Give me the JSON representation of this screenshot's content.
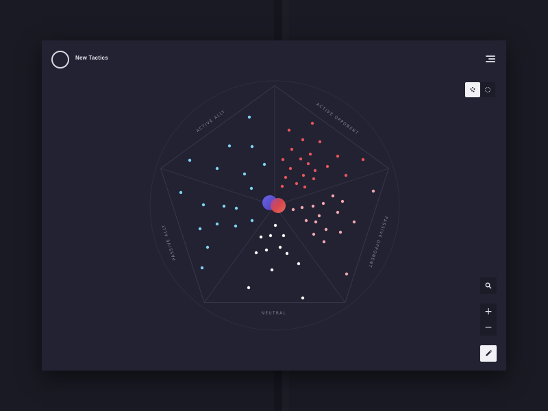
{
  "app": {
    "title": "New Tactics"
  },
  "colors": {
    "background": "#1a1a24",
    "card": "#222232",
    "ally": "#7fd3f2",
    "opponent": "#e8545a",
    "passive_opponent": "#f2a7b0",
    "neutral": "#ffffff",
    "grid": "#3a3a4c"
  },
  "icons": {
    "logo": "ring-logo-icon",
    "menu": "hamburger-menu-icon",
    "view_dots": "dots-cluster-icon",
    "view_circle": "circle-dots-icon",
    "search": "search-icon",
    "zoom_in": "plus-icon",
    "zoom_out": "minus-icon",
    "edit": "pencil-icon"
  },
  "controls": {
    "zoom_in_label": "+",
    "zoom_out_label": "−",
    "active_view": "dots"
  },
  "chart_data": {
    "type": "scatter",
    "categories": [
      "ACTIVE ALLY",
      "ACTIVE OPPONENT",
      "PASSIVE OPPONENT",
      "NEUTRAL",
      "PASSIVE ALLY"
    ],
    "series": [
      {
        "name": "ACTIVE ALLY",
        "color": "#7fd3f2",
        "points": [
          [
            364,
            171
          ],
          [
            335,
            213
          ],
          [
            368,
            214
          ],
          [
            277,
            234
          ],
          [
            386,
            240
          ],
          [
            317,
            246
          ],
          [
            357,
            254
          ],
          [
            367,
            275
          ]
        ]
      },
      {
        "name": "ACTIVE OPPONENT",
        "color": "#e8545a",
        "points": [
          [
            456,
            180
          ],
          [
            422,
            190
          ],
          [
            442,
            204
          ],
          [
            467,
            207
          ],
          [
            426,
            218
          ],
          [
            453,
            225
          ],
          [
            413,
            233
          ],
          [
            439,
            232
          ],
          [
            493,
            228
          ],
          [
            450,
            239
          ],
          [
            478,
            243
          ],
          [
            530,
            233
          ],
          [
            424,
            246
          ],
          [
            460,
            249
          ],
          [
            443,
            256
          ],
          [
            417,
            259
          ],
          [
            505,
            256
          ],
          [
            433,
            268
          ],
          [
            458,
            261
          ],
          [
            412,
            272
          ],
          [
            445,
            273
          ]
        ]
      },
      {
        "name": "PASSIVE OPPONENT",
        "color": "#f2a7b0",
        "points": [
          [
            545,
            279
          ],
          [
            486,
            286
          ],
          [
            472,
            297
          ],
          [
            500,
            294
          ],
          [
            441,
            303
          ],
          [
            457,
            301
          ],
          [
            428,
            306
          ],
          [
            466,
            315
          ],
          [
            493,
            310
          ],
          [
            447,
            322
          ],
          [
            461,
            324
          ],
          [
            517,
            324
          ],
          [
            476,
            335
          ],
          [
            458,
            342
          ],
          [
            497,
            339
          ],
          [
            473,
            353
          ],
          [
            506,
            400
          ]
        ]
      },
      {
        "name": "NEUTRAL",
        "color": "#ffffff",
        "points": [
          [
            402,
            329
          ],
          [
            381,
            346
          ],
          [
            395,
            344
          ],
          [
            414,
            344
          ],
          [
            409,
            361
          ],
          [
            389,
            365
          ],
          [
            374,
            369
          ],
          [
            419,
            370
          ],
          [
            397,
            394
          ],
          [
            436,
            385
          ],
          [
            363,
            420
          ],
          [
            442,
            435
          ]
        ]
      },
      {
        "name": "PASSIVE ALLY",
        "color": "#7fd3f2",
        "points": [
          [
            264,
            281
          ],
          [
            297,
            299
          ],
          [
            327,
            301
          ],
          [
            345,
            304
          ],
          [
            317,
            327
          ],
          [
            344,
            330
          ],
          [
            292,
            334
          ],
          [
            368,
            322
          ],
          [
            303,
            361
          ],
          [
            295,
            391
          ]
        ]
      }
    ],
    "grid": true,
    "legend": "none"
  }
}
